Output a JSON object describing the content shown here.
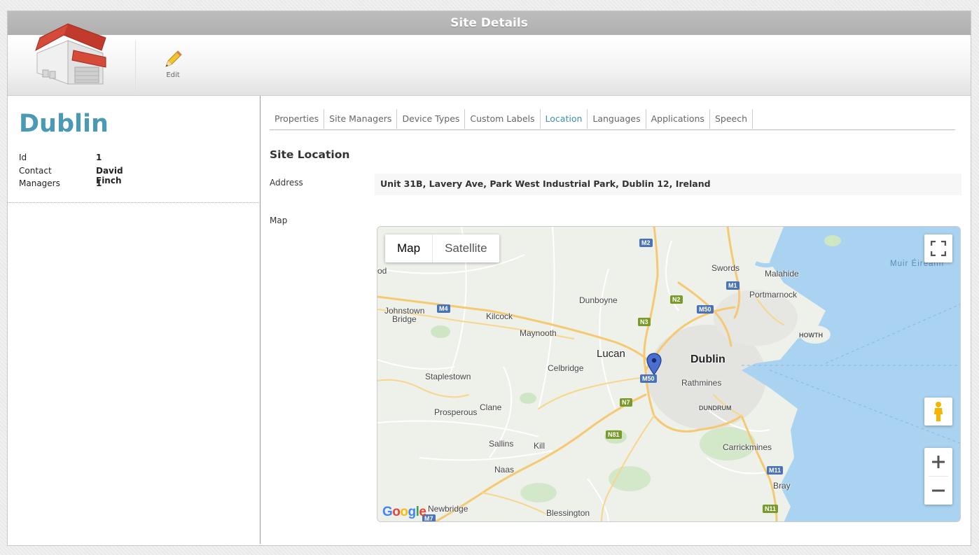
{
  "window": {
    "title": "Site Details"
  },
  "toolbar": {
    "edit_label": "Edit"
  },
  "site": {
    "name": "Dublin",
    "info": [
      {
        "label": "Id",
        "value": "1"
      },
      {
        "label": "Contact",
        "value": "David Finch"
      },
      {
        "label": "Managers",
        "value": "1"
      }
    ]
  },
  "tabs": [
    {
      "label": "Properties",
      "active": false
    },
    {
      "label": "Site Managers",
      "active": false
    },
    {
      "label": "Device Types",
      "active": false
    },
    {
      "label": "Custom Labels",
      "active": false
    },
    {
      "label": "Location",
      "active": true
    },
    {
      "label": "Languages",
      "active": false
    },
    {
      "label": "Applications",
      "active": false
    },
    {
      "label": "Speech",
      "active": false
    }
  ],
  "location": {
    "section_title": "Site Location",
    "address_label": "Address",
    "address_value": "Unit 31B, Lavery Ave, Park West Industrial Park, Dublin 12, Ireland",
    "map_label": "Map"
  },
  "map": {
    "type_options": [
      "Map",
      "Satellite"
    ],
    "selected_type": "Map",
    "google_logo": "Google",
    "places": {
      "dublin": "Dublin",
      "lucan": "Lucan",
      "rathmines": "Rathmines",
      "swords": "Swords",
      "malahide": "Malahide",
      "portmarnock": "Portmarnock",
      "howth": "HOWTH",
      "dunboyne": "Dunboyne",
      "kilcock": "Kilcock",
      "maynooth": "Maynooth",
      "celbridge": "Celbridge",
      "johnstown": "Johnstown",
      "bridge": "Bridge",
      "straplestown": "Staplestown",
      "clane": "Clane",
      "prosperous": "Prosperous",
      "sallins": "Sallins",
      "kill": "Kill",
      "naas": "Naas",
      "newbridge": "Newbridge",
      "blessington": "Blessington",
      "dundrum": "DUNDRUM",
      "carrickmines": "Carrickmines",
      "bray": "Bray",
      "sea": "Muir Éireann",
      "od": "od"
    },
    "roads": {
      "m2": "M2",
      "m1": "M1",
      "n2": "N2",
      "m50a": "M50",
      "m4": "M4",
      "n3": "N3",
      "m50b": "M50",
      "n7": "N7",
      "n81": "N81",
      "m11": "M11",
      "n11": "N11",
      "m7": "M7"
    }
  },
  "colors": {
    "accent": "#4a9ab5",
    "active_tab": "#3e8fb1",
    "titlebar": "#b5b5b5",
    "water": "#a9d3f0",
    "pin": "#4a6fd1"
  }
}
